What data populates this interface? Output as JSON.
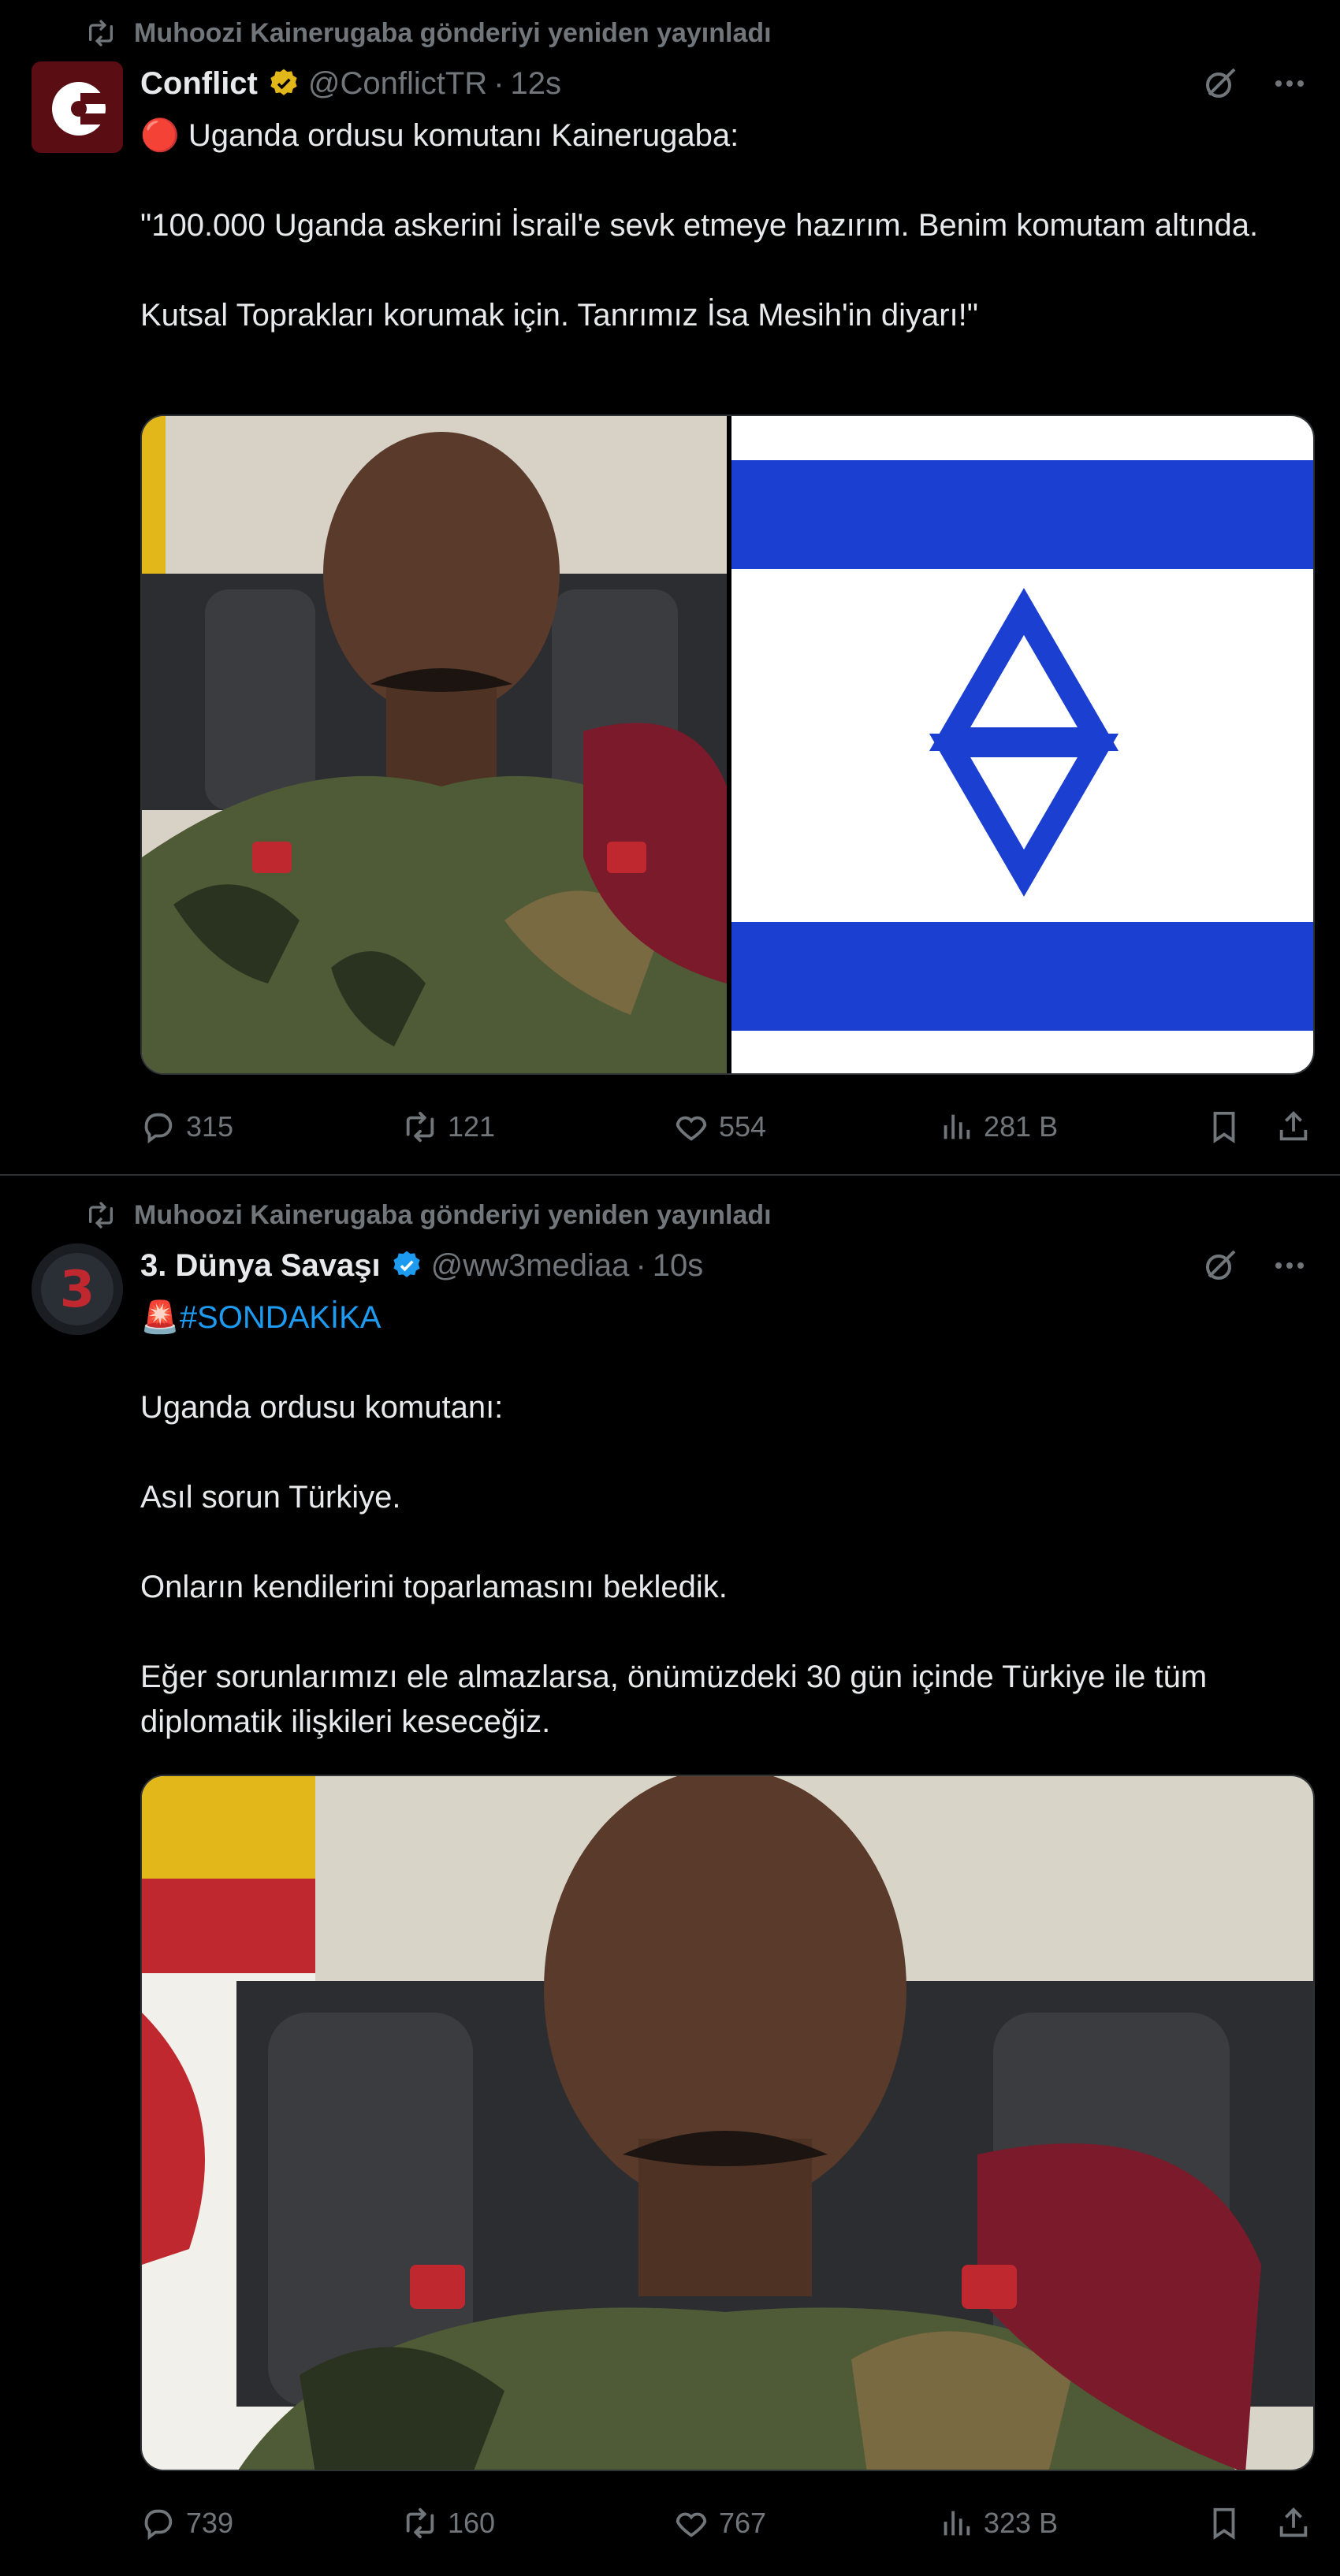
{
  "tweets": [
    {
      "retweeted_by": "Muhoozi Kainerugaba gönderiyi yeniden yayınladı",
      "author_name": "Conflict",
      "author_handle": "@ConflictTR",
      "time": "12s",
      "verified": "gold",
      "text_lines": [
        "🔴 Uganda ordusu komutanı Kainerugaba:",
        "",
        "\"100.000 Uganda askerini İsrail'e sevk etmeye hazırım. Benim komutam altında.",
        "",
        "Kutsal Toprakları korumak için. Tanrımız İsa Mesih'in diyarı!\""
      ],
      "replies": "315",
      "reposts": "121",
      "likes": "554",
      "views": "281 B"
    },
    {
      "retweeted_by": "Muhoozi Kainerugaba gönderiyi yeniden yayınladı",
      "author_name": "3. Dünya Savaşı",
      "author_handle": "@ww3mediaa",
      "time": "10s",
      "verified": "blue",
      "hashtag": "#SONDAKİKA",
      "text_lines": [
        "",
        "Uganda ordusu komutanı:",
        "",
        "Asıl sorun Türkiye.",
        "",
        "Onların kendilerini toparlamasını bekledik.",
        "",
        "Eğer sorunlarımızı ele almazlarsa, önümüzdeki 30 gün içinde Türkiye ile tüm diplomatik ilişkileri keseceğiz."
      ],
      "replies": "739",
      "reposts": "160",
      "likes": "767",
      "views": "323 B"
    }
  ],
  "avatar_letters": {
    "conflict": "C",
    "ww3": "3"
  },
  "icons": {
    "retweet": "retweet-icon",
    "reply": "reply-icon",
    "like": "heart-icon",
    "views": "views-icon",
    "bookmark": "bookmark-icon",
    "share": "share-icon",
    "grok": "grok-icon",
    "more": "more-icon"
  },
  "colors": {
    "background": "#000000",
    "text": "#e7e9ea",
    "muted": "#71767b",
    "link": "#1d9bf0",
    "gold_badge": "#e2b719",
    "blue_badge": "#1d9bf0",
    "flag_blue": "#1a3fd1"
  }
}
